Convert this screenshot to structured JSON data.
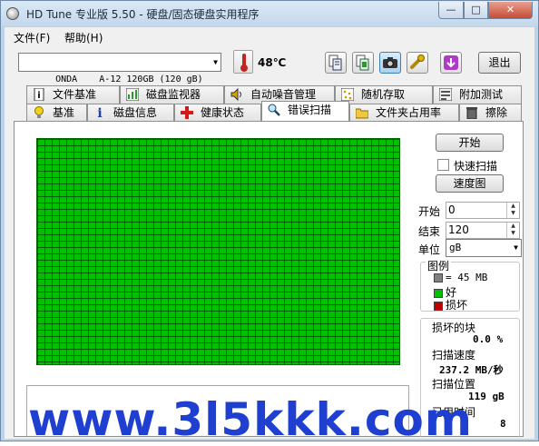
{
  "window": {
    "title": "HD Tune 专业版 5.50 - 硬盘/固态硬盘实用程序",
    "min": "—",
    "max": "□",
    "close": "✕"
  },
  "menu": [
    "文件(F)",
    "帮助(H)"
  ],
  "toolbar": {
    "drive": "ONDA    A-12 120GB (120 gB)",
    "temperature": "48℃",
    "exit_label": "退出",
    "icons": [
      "copy-text-icon",
      "copy-screen-icon",
      "camera-icon",
      "wrench-icon",
      "download-icon"
    ]
  },
  "tabs_top": [
    "文件基准",
    "磁盘监视器",
    "自动噪音管理",
    "随机存取",
    "附加测试"
  ],
  "tabs_bottom": [
    "基准",
    "磁盘信息",
    "健康状态",
    "错误扫描",
    "文件夹占用率",
    "擦除"
  ],
  "active_tab": "错误扫描",
  "scan": {
    "start_button": "开始",
    "quick_scan_label": "快速扫描",
    "quick_scan_checked": false,
    "speed_map_button": "速度图",
    "start_label": "开始",
    "start_value": "0",
    "end_label": "结束",
    "end_value": "120",
    "unit_label": "单位",
    "unit_value": "gB"
  },
  "legend": {
    "title": "图例",
    "block_size": "= 45 MB",
    "good": "好",
    "bad": "损坏",
    "colors": {
      "block": "#808080",
      "good": "#00c000",
      "bad": "#c00000"
    }
  },
  "stats": {
    "damaged_label": "损坏的块",
    "damaged_value": "0.0 %",
    "speed_label": "扫描速度",
    "speed_value": "237.2 MB/秒",
    "position_label": "扫描位置",
    "position_value": "119 gB",
    "elapsed_label": "已用时间",
    "elapsed_value": "8"
  },
  "grid": {
    "status": "all blocks good",
    "color": "#00c000"
  },
  "watermark": "www.3l5kkk.com"
}
